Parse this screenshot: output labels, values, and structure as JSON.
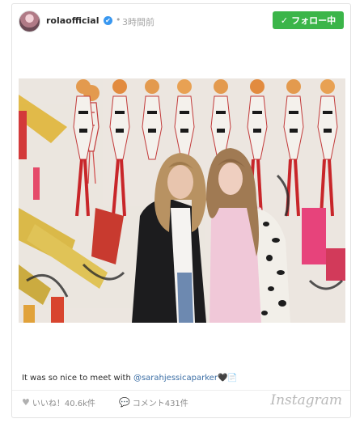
{
  "post": {
    "username": "rolaofficial",
    "verified_glyph": "✔",
    "separator": "•",
    "time_ago": "3時間前",
    "follow_label": "フォロー中",
    "follow_check": "✓",
    "caption_text": "It was so nice to meet with ",
    "caption_mention": "@sarahjessicaparker",
    "caption_emoji": "🖤📄",
    "likes_label": "いいね！40.6k件",
    "comments_label": "コメント431件",
    "brand": "Instagram"
  },
  "icons": {
    "heart": "heart-icon",
    "comment": "comment-bubble-icon",
    "check": "check-icon",
    "verified": "verified-badge-icon"
  },
  "colors": {
    "follow_green": "#3bb549",
    "mention_blue": "#3b6ea5",
    "verified_blue": "#3897f0",
    "muted_gray": "#8c8c8c"
  }
}
